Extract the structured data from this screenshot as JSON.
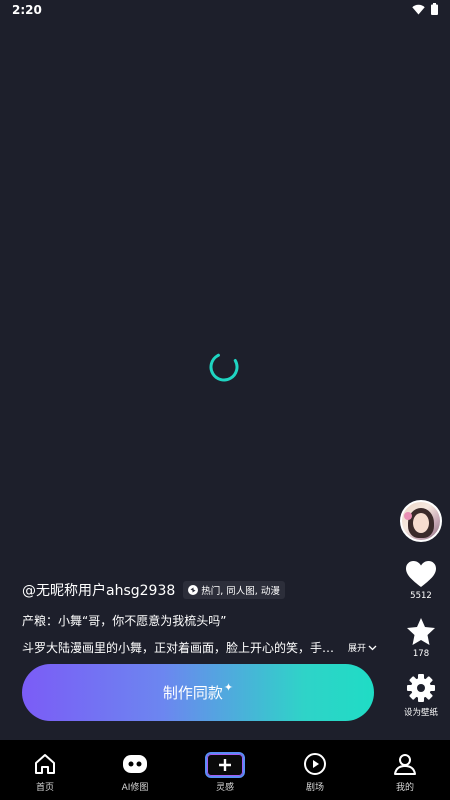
{
  "status_bar": {
    "time": "2:20"
  },
  "right_rail": {
    "like_count": "5512",
    "favorite_count": "178",
    "wallpaper_label": "设为壁纸"
  },
  "post": {
    "username": "@无昵称用户ahsg2938",
    "tags": "热门, 同人图, 动漫",
    "title": "产粮：小舞“哥，你不愿意为我梳头吗”",
    "description": "斗罗大陆漫画里的小舞，正对着画面，脸上开心的笑，手…",
    "expand_label": "展开"
  },
  "cta": {
    "label": "制作同款"
  },
  "bottom_nav": [
    {
      "label": "首页",
      "icon": "home-icon"
    },
    {
      "label": "AI修图",
      "icon": "ai-robot-icon"
    },
    {
      "label": "灵感",
      "icon": "plus-icon"
    },
    {
      "label": "剧场",
      "icon": "play-icon"
    },
    {
      "label": "我的",
      "icon": "profile-icon"
    }
  ],
  "colors": {
    "background": "#1d1f2b",
    "spinner": "#1fd5c2",
    "cta_start": "#7b5cf6",
    "cta_end": "#1fdcc5",
    "nav_background": "#000000"
  }
}
